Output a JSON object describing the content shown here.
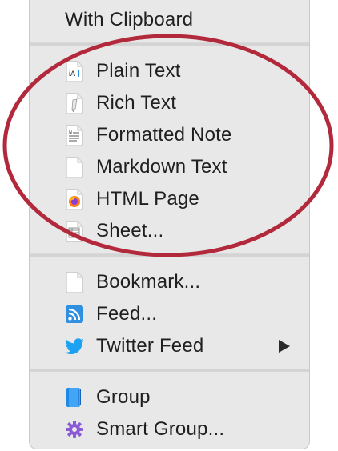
{
  "menu": {
    "header": "With Clipboard",
    "groups": [
      [
        {
          "label": "Plain Text",
          "icon": "plain-text-doc-icon"
        },
        {
          "label": "Rich Text",
          "icon": "rich-text-doc-icon"
        },
        {
          "label": "Formatted Note",
          "icon": "formatted-note-doc-icon"
        },
        {
          "label": "Markdown Text",
          "icon": "markdown-doc-icon"
        },
        {
          "label": "HTML Page",
          "icon": "firefox-icon"
        },
        {
          "label": "Sheet...",
          "icon": "sheet-doc-icon"
        }
      ],
      [
        {
          "label": "Bookmark...",
          "icon": "bookmark-doc-icon"
        },
        {
          "label": "Feed...",
          "icon": "rss-feed-icon"
        },
        {
          "label": "Twitter Feed",
          "icon": "twitter-bird-icon",
          "submenu": true
        }
      ],
      [
        {
          "label": "Group",
          "icon": "group-folder-icon"
        },
        {
          "label": "Smart Group...",
          "icon": "smart-group-gear-icon"
        }
      ]
    ]
  },
  "colors": {
    "menu_background": "#e8e8e8",
    "annotation_ellipse": "#b3293c",
    "rss_orange": "#2f8fe0",
    "twitter_blue": "#1da1f2",
    "smart_group_purple": "#8a5bd6"
  }
}
